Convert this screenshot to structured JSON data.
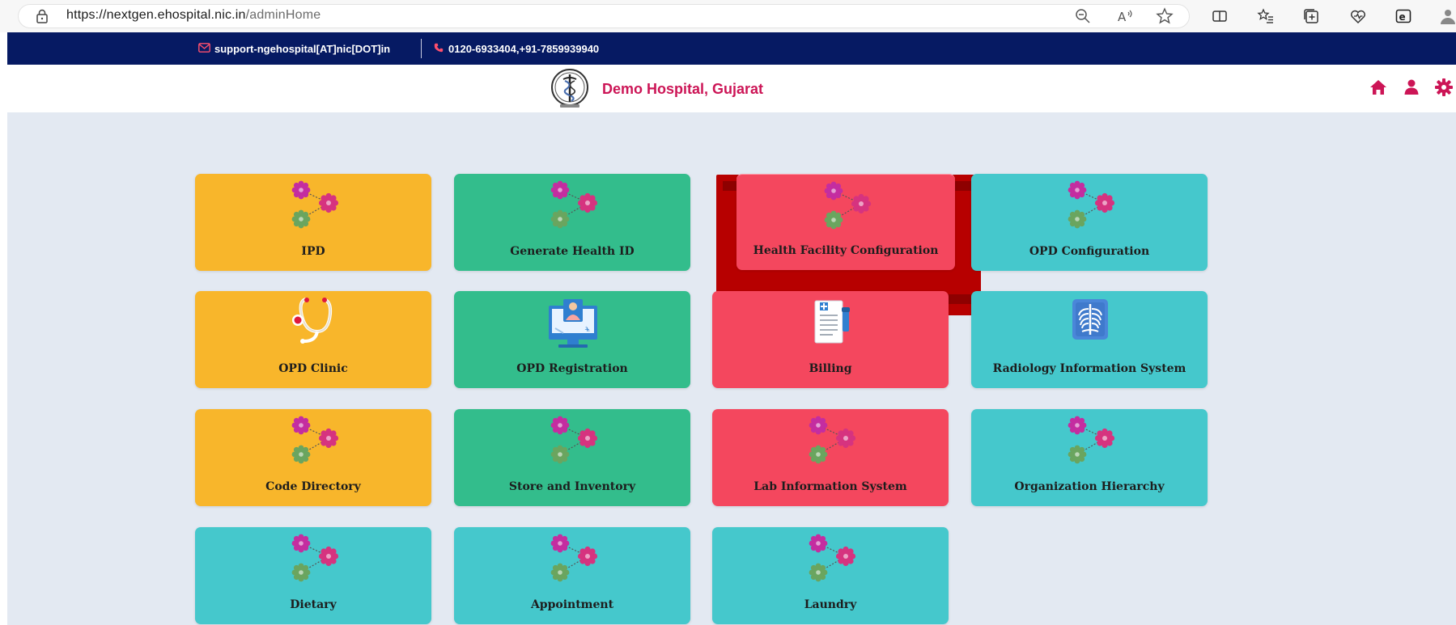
{
  "browser": {
    "url_host": "https://nextgen.ehospital.nic.in",
    "url_path": "/adminHome"
  },
  "topbar": {
    "email": "support-ngehospital[AT]nic[DOT]in",
    "phone": "0120-6933404,+91-7859939940"
  },
  "header": {
    "hospital_name": "Demo Hospital, Gujarat"
  },
  "colors": {
    "navy": "#061a63",
    "brand": "#cc1556",
    "yellow": "#f8b62b",
    "green": "#33bd8c",
    "red": "#f4475e",
    "teal": "#45c8cc",
    "highlight": "#b70000"
  },
  "tiles": [
    {
      "label": "IPD",
      "icon": "gears-icon",
      "color": "yellow"
    },
    {
      "label": "Generate Health ID",
      "icon": "gears-icon",
      "color": "green"
    },
    {
      "label": "Health Facility Configuration",
      "icon": "gears-icon",
      "color": "red",
      "highlighted": true
    },
    {
      "label": "OPD Configuration",
      "icon": "gears-icon",
      "color": "teal"
    },
    {
      "label": "OPD Clinic",
      "icon": "stethoscope-icon",
      "color": "yellow"
    },
    {
      "label": "OPD Registration",
      "icon": "computer-user-icon",
      "color": "green"
    },
    {
      "label": "Billing",
      "icon": "bill-icon",
      "color": "red"
    },
    {
      "label": "Radiology Information System",
      "icon": "xray-icon",
      "color": "teal"
    },
    {
      "label": "Code Directory",
      "icon": "gears-icon",
      "color": "yellow"
    },
    {
      "label": "Store and Inventory",
      "icon": "gears-icon",
      "color": "green"
    },
    {
      "label": "Lab Information System",
      "icon": "gears-icon",
      "color": "red"
    },
    {
      "label": "Organization Hierarchy",
      "icon": "gears-icon",
      "color": "teal"
    },
    {
      "label": "Dietary",
      "icon": "gears-icon",
      "color": "teal"
    },
    {
      "label": "Appointment",
      "icon": "gears-icon",
      "color": "teal"
    },
    {
      "label": "Laundry",
      "icon": "gears-icon",
      "color": "teal"
    }
  ]
}
